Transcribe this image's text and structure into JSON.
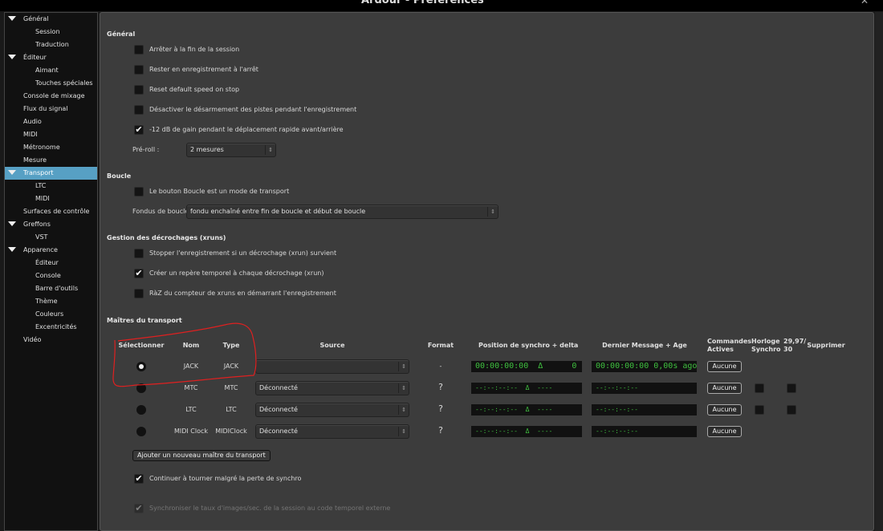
{
  "window": {
    "title": "Ardour - Préférences",
    "close_icon": "close-icon"
  },
  "sidebar": {
    "items": [
      {
        "label": "Général",
        "expanded": true,
        "level": 0
      },
      {
        "label": "Session",
        "level": 1
      },
      {
        "label": "Traduction",
        "level": 1
      },
      {
        "label": "Éditeur",
        "expanded": true,
        "level": 0
      },
      {
        "label": "Aimant",
        "level": 1
      },
      {
        "label": "Touches spéciales",
        "level": 1
      },
      {
        "label": "Console de mixage",
        "level": 0
      },
      {
        "label": "Flux du signal",
        "level": 0
      },
      {
        "label": "Audio",
        "level": 0
      },
      {
        "label": "MIDI",
        "level": 0
      },
      {
        "label": "Métronome",
        "level": 0
      },
      {
        "label": "Mesure",
        "level": 0
      },
      {
        "label": "Transport",
        "expanded": true,
        "level": 0,
        "selected": true
      },
      {
        "label": "LTC",
        "level": 1
      },
      {
        "label": "MIDI",
        "level": 1
      },
      {
        "label": "Surfaces de contrôle",
        "level": 0
      },
      {
        "label": "Greffons",
        "expanded": true,
        "level": 0
      },
      {
        "label": "VST",
        "level": 1
      },
      {
        "label": "Apparence",
        "expanded": true,
        "level": 0
      },
      {
        "label": "Éditeur",
        "level": 1
      },
      {
        "label": "Console",
        "level": 1
      },
      {
        "label": "Barre d'outils",
        "level": 1
      },
      {
        "label": "Thème",
        "level": 1
      },
      {
        "label": "Couleurs",
        "level": 1
      },
      {
        "label": "Excentricités",
        "level": 1
      },
      {
        "label": "Vidéo",
        "level": 0
      }
    ],
    "selected_color": "#57a0c4"
  },
  "general": {
    "heading": "Général",
    "options": [
      {
        "label": "Arrêter à la fin de la session",
        "checked": false
      },
      {
        "label": "Rester en enregistrement à l'arrêt",
        "checked": false
      },
      {
        "label": "Reset default speed on stop",
        "checked": false
      },
      {
        "label": "Désactiver le désarmement des pistes pendant l'enregistrement",
        "checked": false
      },
      {
        "label": "-12 dB de gain pendant le déplacement rapide avant/arrière",
        "checked": true
      }
    ],
    "preroll_label": "Pré-roll :",
    "preroll_value": "2 mesures"
  },
  "loop": {
    "heading": "Boucle",
    "option": {
      "label": "Le bouton Boucle est un mode de transport",
      "checked": false
    },
    "fade_label": "Fondus de boucle :",
    "fade_value": "fondu enchaîné entre fin de boucle et début de boucle"
  },
  "xruns": {
    "heading": "Gestion des décrochages (xruns)",
    "options": [
      {
        "label": "Stopper l'enregistrement si un décrochage (xrun) survient",
        "checked": false
      },
      {
        "label": "Créer un repère temporel à chaque décrochage (xrun)",
        "checked": true
      },
      {
        "label": "RàZ du compteur de xruns en démarrant l'enregistrement",
        "checked": false
      }
    ]
  },
  "masters": {
    "heading": "Maîtres du transport",
    "columns": {
      "select": "Sélectionner",
      "name": "Nom",
      "type": "Type",
      "source": "Source",
      "format": "Format",
      "position": "Position de synchro + delta",
      "last": "Dernier Message + Age",
      "commands1": "Commandes",
      "commands2": "Actives",
      "clock1": "Horloge",
      "clock2": "Synchro",
      "fps1": "29,97/",
      "fps2": "30",
      "delete": "Supprimer"
    },
    "rows": [
      {
        "selected": true,
        "name": "JACK",
        "type": "JACK",
        "source": "",
        "format": "-",
        "position": "00:00:00:00  Δ      0",
        "last": "00:00:00:00 0,00s ago",
        "commands": "Aucune",
        "has_checks": false
      },
      {
        "selected": false,
        "name": "MTC",
        "type": "MTC",
        "source": "Déconnecté",
        "format": "?",
        "position": "--:--:--:--  Δ  ----",
        "last": "--:--:--:--",
        "commands": "Aucune",
        "has_checks": true,
        "clock_checked": false,
        "fps_checked": false
      },
      {
        "selected": false,
        "name": "LTC",
        "type": "LTC",
        "source": "Déconnecté",
        "format": "?",
        "position": "--:--:--:--  Δ  ----",
        "last": "--:--:--:--",
        "commands": "Aucune",
        "has_checks": true,
        "clock_checked": false,
        "fps_checked": false
      },
      {
        "selected": false,
        "name": "MIDI Clock",
        "type": "MIDIClock",
        "source": "Déconnecté",
        "format": "?",
        "position": "--:--:--:--  Δ  ----",
        "last": "--:--:--:--",
        "commands": "Aucune",
        "has_checks": false
      }
    ],
    "add_button": "Ajouter un nouveau maître du transport",
    "continue": {
      "label": "Continuer à tourner malgré la perte de synchro",
      "checked": true
    },
    "sync_fps": {
      "label": "Synchroniser le taux d'images/sec. de la session au code temporel externe",
      "checked": true,
      "disabled": true
    },
    "clock_color": "#3fbf3f",
    "annotation_color": "#e02020"
  }
}
